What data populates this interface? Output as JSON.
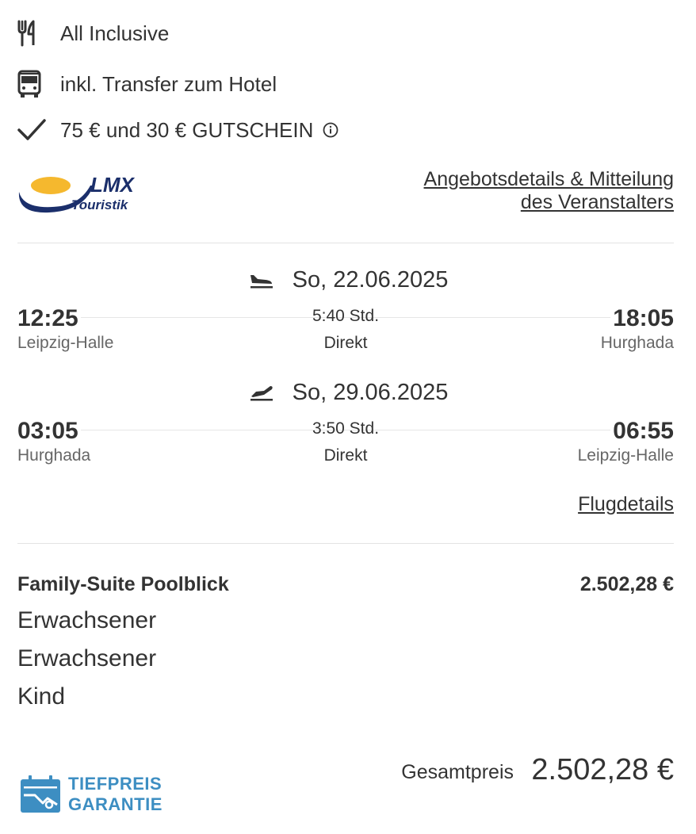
{
  "features": [
    {
      "icon": "cutlery-icon",
      "label": "All Inclusive"
    },
    {
      "icon": "bus-icon",
      "label": "inkl. Transfer zum Hotel"
    },
    {
      "icon": "checkmark-icon",
      "label": "75 € und 30 € GUTSCHEIN"
    }
  ],
  "operator": {
    "logo_text_top": "LMX",
    "logo_text_bottom": "Touristik",
    "offer_link_line1": "Angebotsdetails & Mitteilung",
    "offer_link_line2": "des Veranstalters"
  },
  "flights": [
    {
      "direction": "outbound",
      "date": "So, 22.06.2025",
      "departure_time": "12:25",
      "departure_city": "Leipzig-Halle",
      "duration": "5:40 Std.",
      "stops": "Direkt",
      "arrival_time": "18:05",
      "arrival_city": "Hurghada"
    },
    {
      "direction": "return",
      "date": "So, 29.06.2025",
      "departure_time": "03:05",
      "departure_city": "Hurghada",
      "duration": "3:50 Std.",
      "stops": "Direkt",
      "arrival_time": "06:55",
      "arrival_city": "Leipzig-Halle"
    }
  ],
  "flight_details_link": "Flugdetails",
  "room": {
    "name": "Family-Suite Poolblick",
    "price": "2.502,28 €",
    "travelers": [
      "Erwachsener",
      "Erwachsener",
      "Kind"
    ]
  },
  "badge": {
    "line1": "TIEFPREIS",
    "line2": "GARANTIE",
    "color": "#3d8ec2"
  },
  "total": {
    "label": "Gesamtpreis",
    "price": "2.502,28 €"
  },
  "colors": {
    "text": "#333333",
    "muted": "#666666",
    "divider": "#e3e3e3",
    "logo_yellow": "#f5b82e",
    "logo_navy": "#1b2f6b"
  }
}
